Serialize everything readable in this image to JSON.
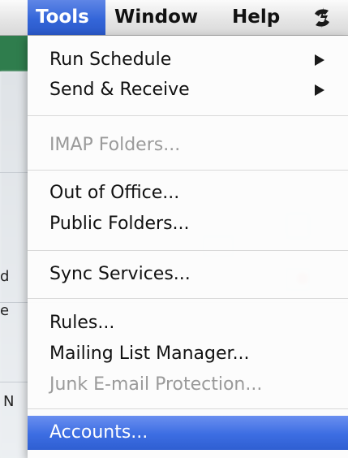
{
  "menubar": {
    "items": [
      {
        "label": "Tools",
        "active": true
      },
      {
        "label": "Window",
        "active": false
      },
      {
        "label": "Help",
        "active": false
      }
    ],
    "script_icon": "applescript-icon"
  },
  "tools_menu": {
    "items": [
      {
        "label": "Run Schedule",
        "enabled": true,
        "has_submenu": true
      },
      {
        "label": "Send & Receive",
        "enabled": true,
        "has_submenu": true
      },
      {
        "label": "IMAP Folders...",
        "enabled": false,
        "has_submenu": false
      },
      {
        "label": "Out of Office...",
        "enabled": true,
        "has_submenu": false
      },
      {
        "label": "Public Folders...",
        "enabled": true,
        "has_submenu": false
      },
      {
        "label": "Sync Services...",
        "enabled": true,
        "has_submenu": false
      },
      {
        "label": "Rules...",
        "enabled": true,
        "has_submenu": false
      },
      {
        "label": "Mailing List Manager...",
        "enabled": true,
        "has_submenu": false
      },
      {
        "label": "Junk E-mail Protection...",
        "enabled": false,
        "has_submenu": false
      },
      {
        "label": "Accounts...",
        "enabled": true,
        "has_submenu": false,
        "highlighted": true
      }
    ]
  },
  "background": {
    "fragments": [
      "d",
      "e",
      "N"
    ]
  },
  "colors": {
    "highlight": "#3c6de2",
    "menubar_bg": "#e6e6e6",
    "disabled_text": "#9a9a9a",
    "sidebar_green": "#2f7d4d"
  }
}
